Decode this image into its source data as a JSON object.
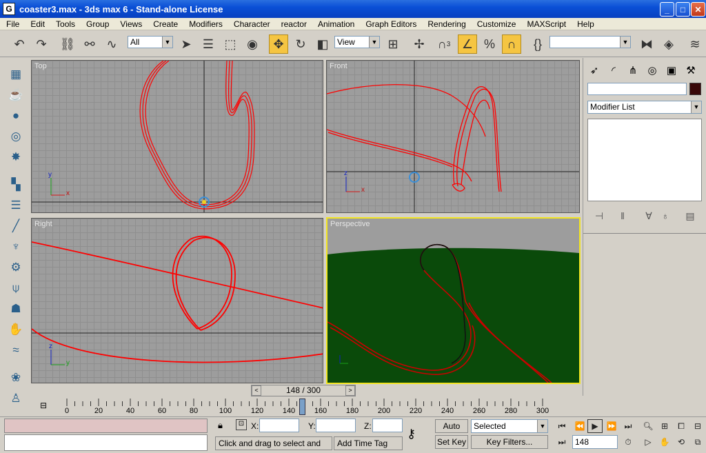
{
  "window": {
    "title": "coaster3.max - 3ds max 6 - Stand-alone License",
    "app_icon": "G",
    "minimize": "_",
    "maximize": "□",
    "close": "✕"
  },
  "menu": [
    "File",
    "Edit",
    "Tools",
    "Group",
    "Views",
    "Create",
    "Modifiers",
    "Character",
    "reactor",
    "Animation",
    "Graph Editors",
    "Rendering",
    "Customize",
    "MAXScript",
    "Help"
  ],
  "toolbar": {
    "selection_filter": "All",
    "reference_coord": "View",
    "snap_count": "3",
    "named_selection": ""
  },
  "viewports": {
    "top": "Top",
    "front": "Front",
    "right": "Right",
    "perspective": "Perspective"
  },
  "axis": {
    "x": "x",
    "y": "y",
    "z": "z"
  },
  "command_panel": {
    "modifier_list": "Modifier List",
    "object_color": "#3a0808"
  },
  "time_slider": {
    "label": "148 / 300",
    "left": "<",
    "right": ">",
    "ticks": [
      "0",
      "20",
      "40",
      "60",
      "80",
      "100",
      "120",
      "140",
      "160",
      "180",
      "200",
      "220",
      "240",
      "260",
      "280",
      "300"
    ]
  },
  "status": {
    "x_label": "X:",
    "y_label": "Y:",
    "z_label": "Z:",
    "prompt": "Click and drag to select and move",
    "add_time_tag": "Add Time Tag",
    "auto_key": "Auto Key",
    "set_key": "Set Key",
    "selected": "Selected",
    "key_filters": "Key Filters...",
    "current_frame": "148"
  },
  "colors": {
    "spline": "#ff0000",
    "active_border": "#f2e420",
    "ground": "#0a4a0a",
    "viewport_bg": "#9d9d9d"
  }
}
